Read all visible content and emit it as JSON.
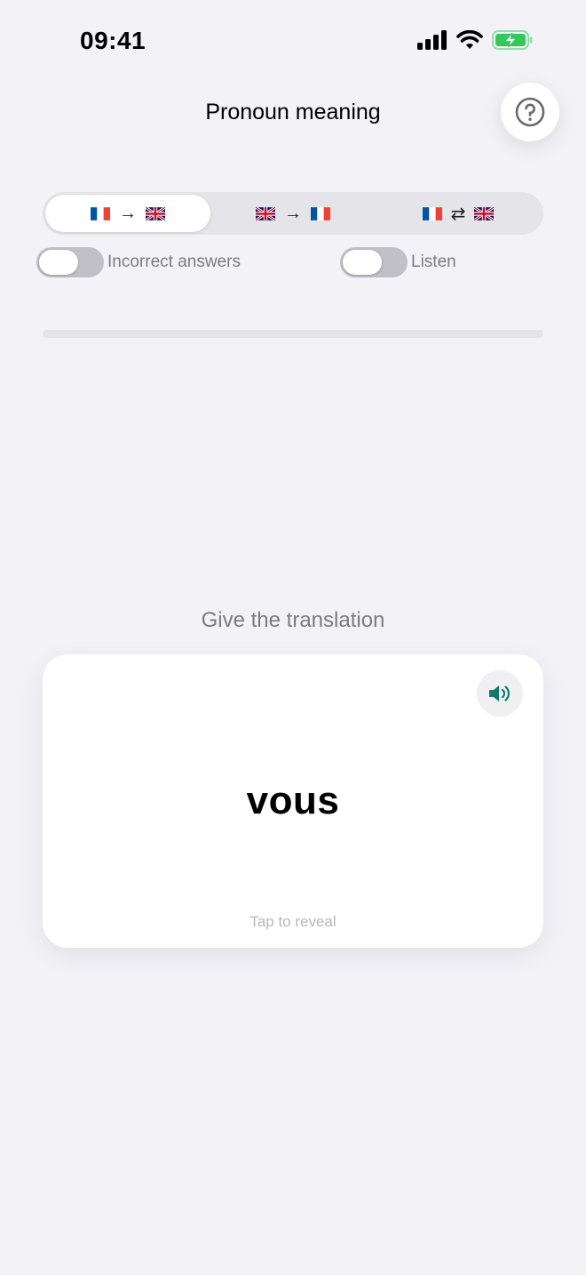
{
  "status_bar": {
    "time": "09:41"
  },
  "header": {
    "title": "Pronoun meaning"
  },
  "direction_options": [
    {
      "arrow": "→",
      "active": true
    },
    {
      "arrow": "→",
      "active": false
    },
    {
      "arrow": "⇄",
      "active": false
    }
  ],
  "toggles": {
    "incorrect_answers": {
      "label": "Incorrect answers",
      "on": false
    },
    "listen": {
      "label": "Listen",
      "on": false
    }
  },
  "progress": {
    "fraction": 0
  },
  "prompt": "Give the translation",
  "card": {
    "word": "vous",
    "hint": "Tap to reveal"
  },
  "colors": {
    "accent": "#0f7a6b",
    "background": "#f2f2f7",
    "battery": "#34c759"
  },
  "icons": [
    "cellular-icon",
    "wifi-icon",
    "battery-icon",
    "help-icon",
    "speaker-icon",
    "flag-fr-icon",
    "flag-gb-icon"
  ]
}
